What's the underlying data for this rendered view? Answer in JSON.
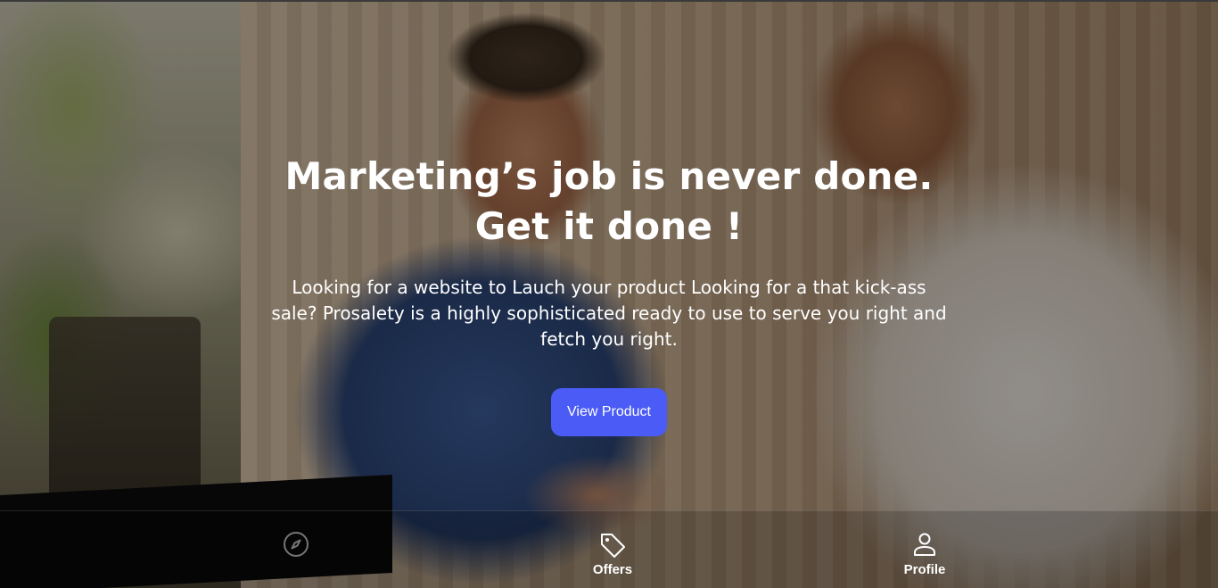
{
  "hero": {
    "headline_line1": "Marketing’s job is never done.",
    "headline_line2": "Get it done !",
    "subtext": "Looking for a website to Lauch your product Looking for a that kick-ass sale? Prosalety is a highly sophisticated ready to use to serve you right and fetch you right.",
    "cta_label": "View Product",
    "cta_color": "#4a5cf5"
  },
  "bottom_nav": {
    "items": [
      {
        "icon": "compass-icon",
        "label": ""
      },
      {
        "icon": "tag-icon",
        "label": "Offers"
      },
      {
        "icon": "person-icon",
        "label": "Profile"
      }
    ]
  }
}
